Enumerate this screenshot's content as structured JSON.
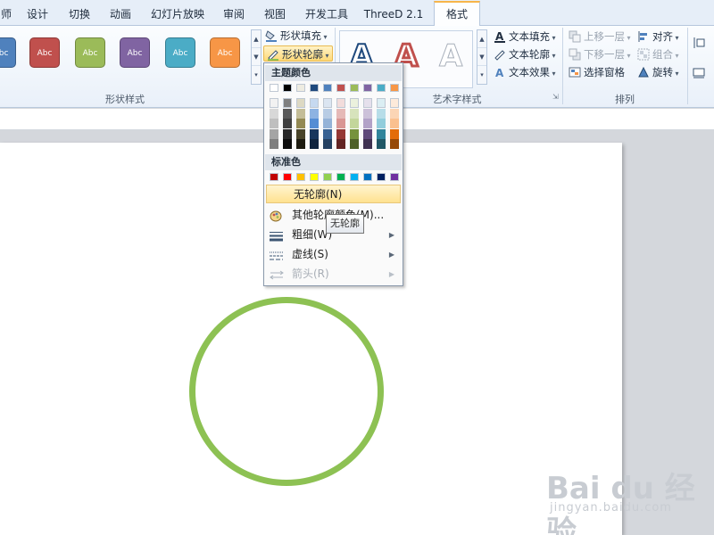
{
  "tabs": [
    {
      "label": "师"
    },
    {
      "label": "设计"
    },
    {
      "label": "切换"
    },
    {
      "label": "动画"
    },
    {
      "label": "幻灯片放映"
    },
    {
      "label": "审阅"
    },
    {
      "label": "视图"
    },
    {
      "label": "开发工具"
    },
    {
      "label": "ThreeD 2.1"
    },
    {
      "label": "格式"
    }
  ],
  "shape_styles": {
    "swatch_text": "Abc",
    "colors": [
      "#4f81bd",
      "#c0504d",
      "#9bbb59",
      "#8064a2",
      "#4bacc6",
      "#f79646"
    ],
    "group_label": "形状样式",
    "fill_button": "形状填充",
    "outline_button": "形状轮廓"
  },
  "wordart": {
    "letter": "A",
    "group_label": "艺术字样式",
    "text_fill": "文本填充",
    "text_outline": "文本轮廓",
    "text_effect": "文本效果"
  },
  "arrange": {
    "group_label": "排列",
    "bring_forward": "上移一层",
    "send_backward": "下移一层",
    "selection_pane": "选择窗格",
    "align": "对齐",
    "group": "组合",
    "rotate": "旋转"
  },
  "dropdown": {
    "theme_colors_header": "主题颜色",
    "standard_colors_header": "标准色",
    "theme_top_row": [
      "#ffffff",
      "#000000",
      "#eeece1",
      "#1f497d",
      "#4f81bd",
      "#c0504d",
      "#9bbb59",
      "#8064a2",
      "#4bacc6",
      "#f79646"
    ],
    "theme_shades": [
      [
        "#f2f2f2",
        "#7f7f7f",
        "#ddd9c3",
        "#c6d9f0",
        "#dbe5f1",
        "#f2dcdb",
        "#ebf1dd",
        "#e5e0ec",
        "#dbeef3",
        "#fdeada"
      ],
      [
        "#d8d8d8",
        "#595959",
        "#c4bd97",
        "#8db3e2",
        "#b8cce4",
        "#e5b9b7",
        "#d7e3bc",
        "#ccc1d9",
        "#b7dde8",
        "#fbd5b5"
      ],
      [
        "#bfbfbf",
        "#3f3f3f",
        "#938953",
        "#548dd4",
        "#95b3d7",
        "#d99694",
        "#c3d69b",
        "#b2a2c7",
        "#92cddc",
        "#fac08f"
      ],
      [
        "#a5a5a5",
        "#262626",
        "#494429",
        "#17365d",
        "#366092",
        "#953734",
        "#76923c",
        "#5f497a",
        "#31859b",
        "#e36c09"
      ],
      [
        "#7f7f7f",
        "#0c0c0c",
        "#1d1b10",
        "#0f243e",
        "#244061",
        "#632423",
        "#4f6128",
        "#3f3151",
        "#205867",
        "#974806"
      ]
    ],
    "standard_colors": [
      "#c00000",
      "#ff0000",
      "#ffc000",
      "#ffff00",
      "#92d050",
      "#00b050",
      "#00b0f0",
      "#0070c0",
      "#002060",
      "#7030a0"
    ],
    "no_outline": "无轮廓(N)",
    "more_colors": "其他轮廓颜色(M)...",
    "weight": "粗细(W)",
    "dashes": "虚线(S)",
    "arrows": "箭头(R)"
  },
  "tooltip": "无轮廓",
  "shape": {
    "outline_color": "#8dc153"
  },
  "watermark": {
    "brand": "Bai du 经验",
    "url": "jingyan.baidu.com"
  }
}
